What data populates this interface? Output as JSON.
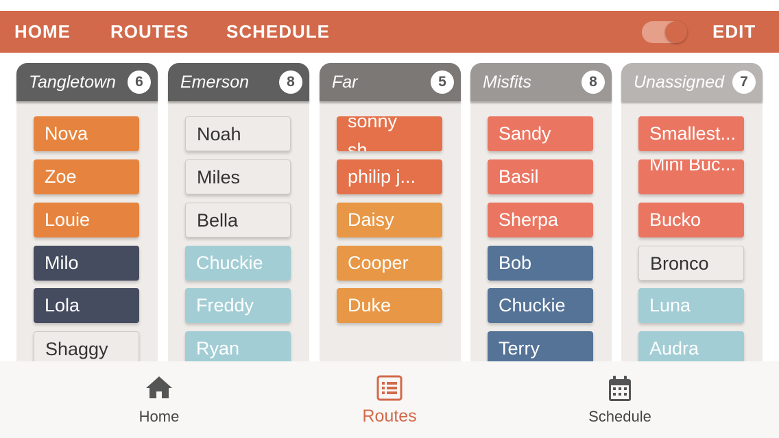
{
  "topnav": {
    "home": "HOME",
    "routes": "ROUTES",
    "schedule": "SCHEDULE",
    "edit": "EDIT",
    "toggle_on": true
  },
  "colors": {
    "accent": "#d2694a",
    "orange": "#e6843f",
    "light_orange": "#e79745",
    "red_orange": "#e4714a",
    "salmon": "#ea7662",
    "navy": "#454c5f",
    "steel_blue": "#547396",
    "light_teal": "#a2cdd4",
    "white_card": "#efebe8"
  },
  "columns": [
    {
      "name": "Tangletown",
      "count": "6",
      "header_color": "#5f5f5f",
      "cards": [
        {
          "label": "Nova",
          "color": "#e6843f"
        },
        {
          "label": "Zoe",
          "color": "#e6843f"
        },
        {
          "label": "Louie",
          "color": "#e6843f"
        },
        {
          "label": "Milo",
          "color": "#454c5f"
        },
        {
          "label": "Lola",
          "color": "#454c5f"
        },
        {
          "label": "Shaggy",
          "color": "#efebe8"
        }
      ]
    },
    {
      "name": "Emerson",
      "count": "8",
      "header_color": "#5f5f5f",
      "cards": [
        {
          "label": "Noah",
          "color": "#efebe8"
        },
        {
          "label": "Miles",
          "color": "#efebe8"
        },
        {
          "label": "Bella",
          "color": "#efebe8"
        },
        {
          "label": "Chuckie",
          "color": "#a2cdd4"
        },
        {
          "label": "Freddy",
          "color": "#a2cdd4"
        },
        {
          "label": "Ryan",
          "color": "#a2cdd4"
        }
      ]
    },
    {
      "name": "Far",
      "count": "5",
      "header_color": "#7b7876",
      "cards": [
        {
          "label": "sonny sh...",
          "color": "#e4714a"
        },
        {
          "label": "philip j...",
          "color": "#e4714a"
        },
        {
          "label": "Daisy",
          "color": "#e79745"
        },
        {
          "label": "Cooper",
          "color": "#e79745"
        },
        {
          "label": "Duke",
          "color": "#e79745"
        }
      ]
    },
    {
      "name": "Misfits",
      "count": "8",
      "header_color": "#9c9896",
      "cards": [
        {
          "label": "Sandy",
          "color": "#ea7662"
        },
        {
          "label": "Basil",
          "color": "#ea7662"
        },
        {
          "label": "Sherpa",
          "color": "#ea7662"
        },
        {
          "label": "Bob",
          "color": "#547396"
        },
        {
          "label": "Chuckie",
          "color": "#547396"
        },
        {
          "label": "Terry",
          "color": "#547396"
        }
      ]
    },
    {
      "name": "Unassigned",
      "count": "7",
      "header_color": "#b8b4b2",
      "cards": [
        {
          "label": "Smallest...",
          "color": "#ea7662"
        },
        {
          "label": "Mini Buc...",
          "color": "#ea7662"
        },
        {
          "label": "Bucko",
          "color": "#ea7662"
        },
        {
          "label": "Bronco",
          "color": "#efebe8"
        },
        {
          "label": "Luna",
          "color": "#a2cdd4"
        },
        {
          "label": "Audra",
          "color": "#a2cdd4"
        }
      ]
    }
  ],
  "tabbar": {
    "home": {
      "label": "Home",
      "icon": "home-icon"
    },
    "routes": {
      "label": "Routes",
      "icon": "list-icon"
    },
    "schedule": {
      "label": "Schedule",
      "icon": "calendar-icon"
    },
    "active": "routes"
  }
}
